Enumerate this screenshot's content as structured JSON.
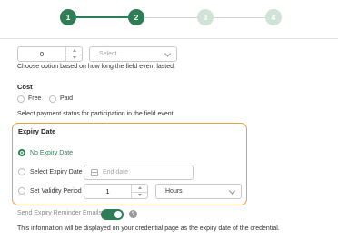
{
  "stepper": {
    "steps": [
      "1",
      "2",
      "3",
      "4"
    ],
    "current_step": 2
  },
  "duration": {
    "value": "0",
    "unit_placeholder": "Select",
    "helper": "Choose option based on how long the field event lasted."
  },
  "cost": {
    "heading": "Cost",
    "options": [
      "Free",
      "Paid"
    ],
    "selected": null,
    "helper": "Select payment status for participation in the field event."
  },
  "expiry": {
    "heading": "Expiry Date",
    "options": [
      "No Expiry Date",
      "Select Expiry Date",
      "Set Validity Period"
    ],
    "selected": "No Expiry Date",
    "end_date_placeholder": "End date",
    "validity_value": "1",
    "validity_unit": "Hours"
  },
  "reminder": {
    "label": "Send Expiry Reminder Emails",
    "enabled": true,
    "help_icon": "?",
    "note": "This information will be displayed on your credential page as the expiry date of the credential."
  },
  "colors": {
    "accent": "#2f7d57",
    "accent_light": "#cfe3d6",
    "highlight_border": "#e8a43a"
  }
}
